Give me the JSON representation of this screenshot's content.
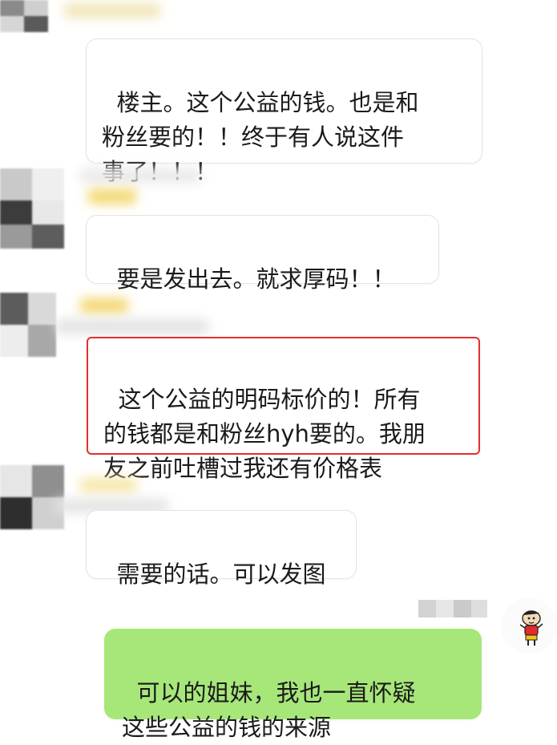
{
  "chat": {
    "messages": [
      {
        "sender": "other",
        "text": "楼主。这个公益的钱。也是和\n粉丝要的！！终于有人说这件\n事了！！！"
      },
      {
        "sender": "other",
        "text": "要是发出去。就求厚码！！"
      },
      {
        "sender": "other",
        "text": "这个公益的明码标价的！所有\n的钱都是和粉丝hyh要的。我朋\n友之前吐槽过我还有价格表",
        "highlighted": true
      },
      {
        "sender": "other",
        "text": "需要的话。可以发图"
      },
      {
        "sender": "self",
        "text": "可以的姐妹，我也一直怀疑\n这些公益的钱的来源"
      }
    ]
  },
  "colors": {
    "self_bubble": "#a7e77a",
    "other_bubble": "#ffffff",
    "highlight_border": "#e3302b"
  },
  "icons": {
    "self_avatar": "cartoon-boy-sticker-icon"
  }
}
